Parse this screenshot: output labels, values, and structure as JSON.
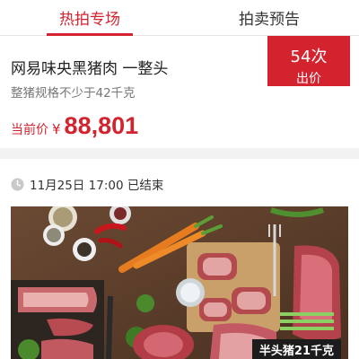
{
  "tabs": [
    {
      "label": "热拍专场",
      "active": true
    },
    {
      "label": "拍卖预告",
      "active": false
    }
  ],
  "item": {
    "title": "网易味央黑猪肉 一整头",
    "subtitle": "整猪规格不少于42千克",
    "bids": {
      "count": "54次",
      "label": "出价"
    },
    "price": {
      "label": "当前价",
      "currency": "¥",
      "value": "88,801"
    }
  },
  "auction": {
    "status": "11月25日 17:00 已结束",
    "status_icon": "clock-icon",
    "photo_tag": "半头猪21千克"
  },
  "colors": {
    "accent": "#d3232f",
    "tag_bg": "#1c1c1c"
  }
}
